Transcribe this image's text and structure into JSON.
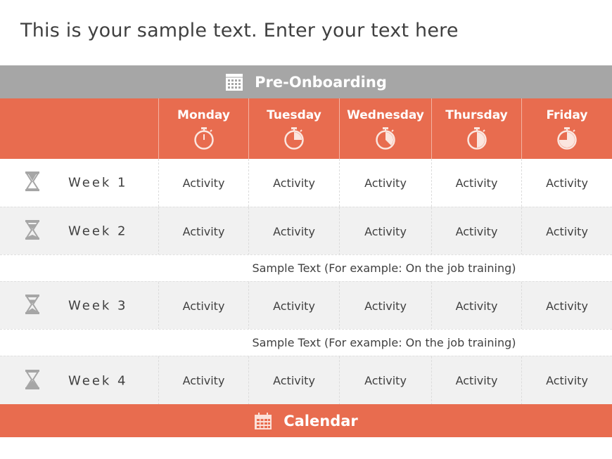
{
  "title": "This is your sample text. Enter your text here",
  "top_bar": {
    "label": "Pre-Onboarding",
    "icon": "calendar-icon",
    "color": "#a6a6a6"
  },
  "bottom_bar": {
    "label": "Calendar",
    "icon": "calendar-icon",
    "color": "#e86c4f"
  },
  "accent_color": "#e86c4f",
  "days": [
    {
      "label": "Monday",
      "icon": "stopwatch-icon",
      "progress": 0
    },
    {
      "label": "Tuesday",
      "icon": "stopwatch-icon",
      "progress": 0.25
    },
    {
      "label": "Wednesday",
      "icon": "stopwatch-icon",
      "progress": 0.375
    },
    {
      "label": "Thursday",
      "icon": "stopwatch-icon",
      "progress": 0.5
    },
    {
      "label": "Friday",
      "icon": "stopwatch-icon",
      "progress": 0.75
    }
  ],
  "weeks": [
    {
      "label": "Week 1",
      "icon": "hourglass-icon",
      "progress": 0,
      "activities": [
        "Activity",
        "Activity",
        "Activity",
        "Activity",
        "Activity"
      ]
    },
    {
      "label": "Week 2",
      "icon": "hourglass-icon",
      "progress": 0.33,
      "activities": [
        "Activity",
        "Activity",
        "Activity",
        "Activity",
        "Activity"
      ]
    },
    {
      "label": "Week 3",
      "icon": "hourglass-icon",
      "progress": 0.5,
      "activities": [
        "Activity",
        "Activity",
        "Activity",
        "Activity",
        "Activity"
      ]
    },
    {
      "label": "Week 4",
      "icon": "hourglass-icon",
      "progress": 1,
      "activities": [
        "Activity",
        "Activity",
        "Activity",
        "Activity",
        "Activity"
      ]
    }
  ],
  "sample_rows": [
    "Sample Text (For example: On the job training)",
    "Sample Text (For example: On the job training)"
  ]
}
